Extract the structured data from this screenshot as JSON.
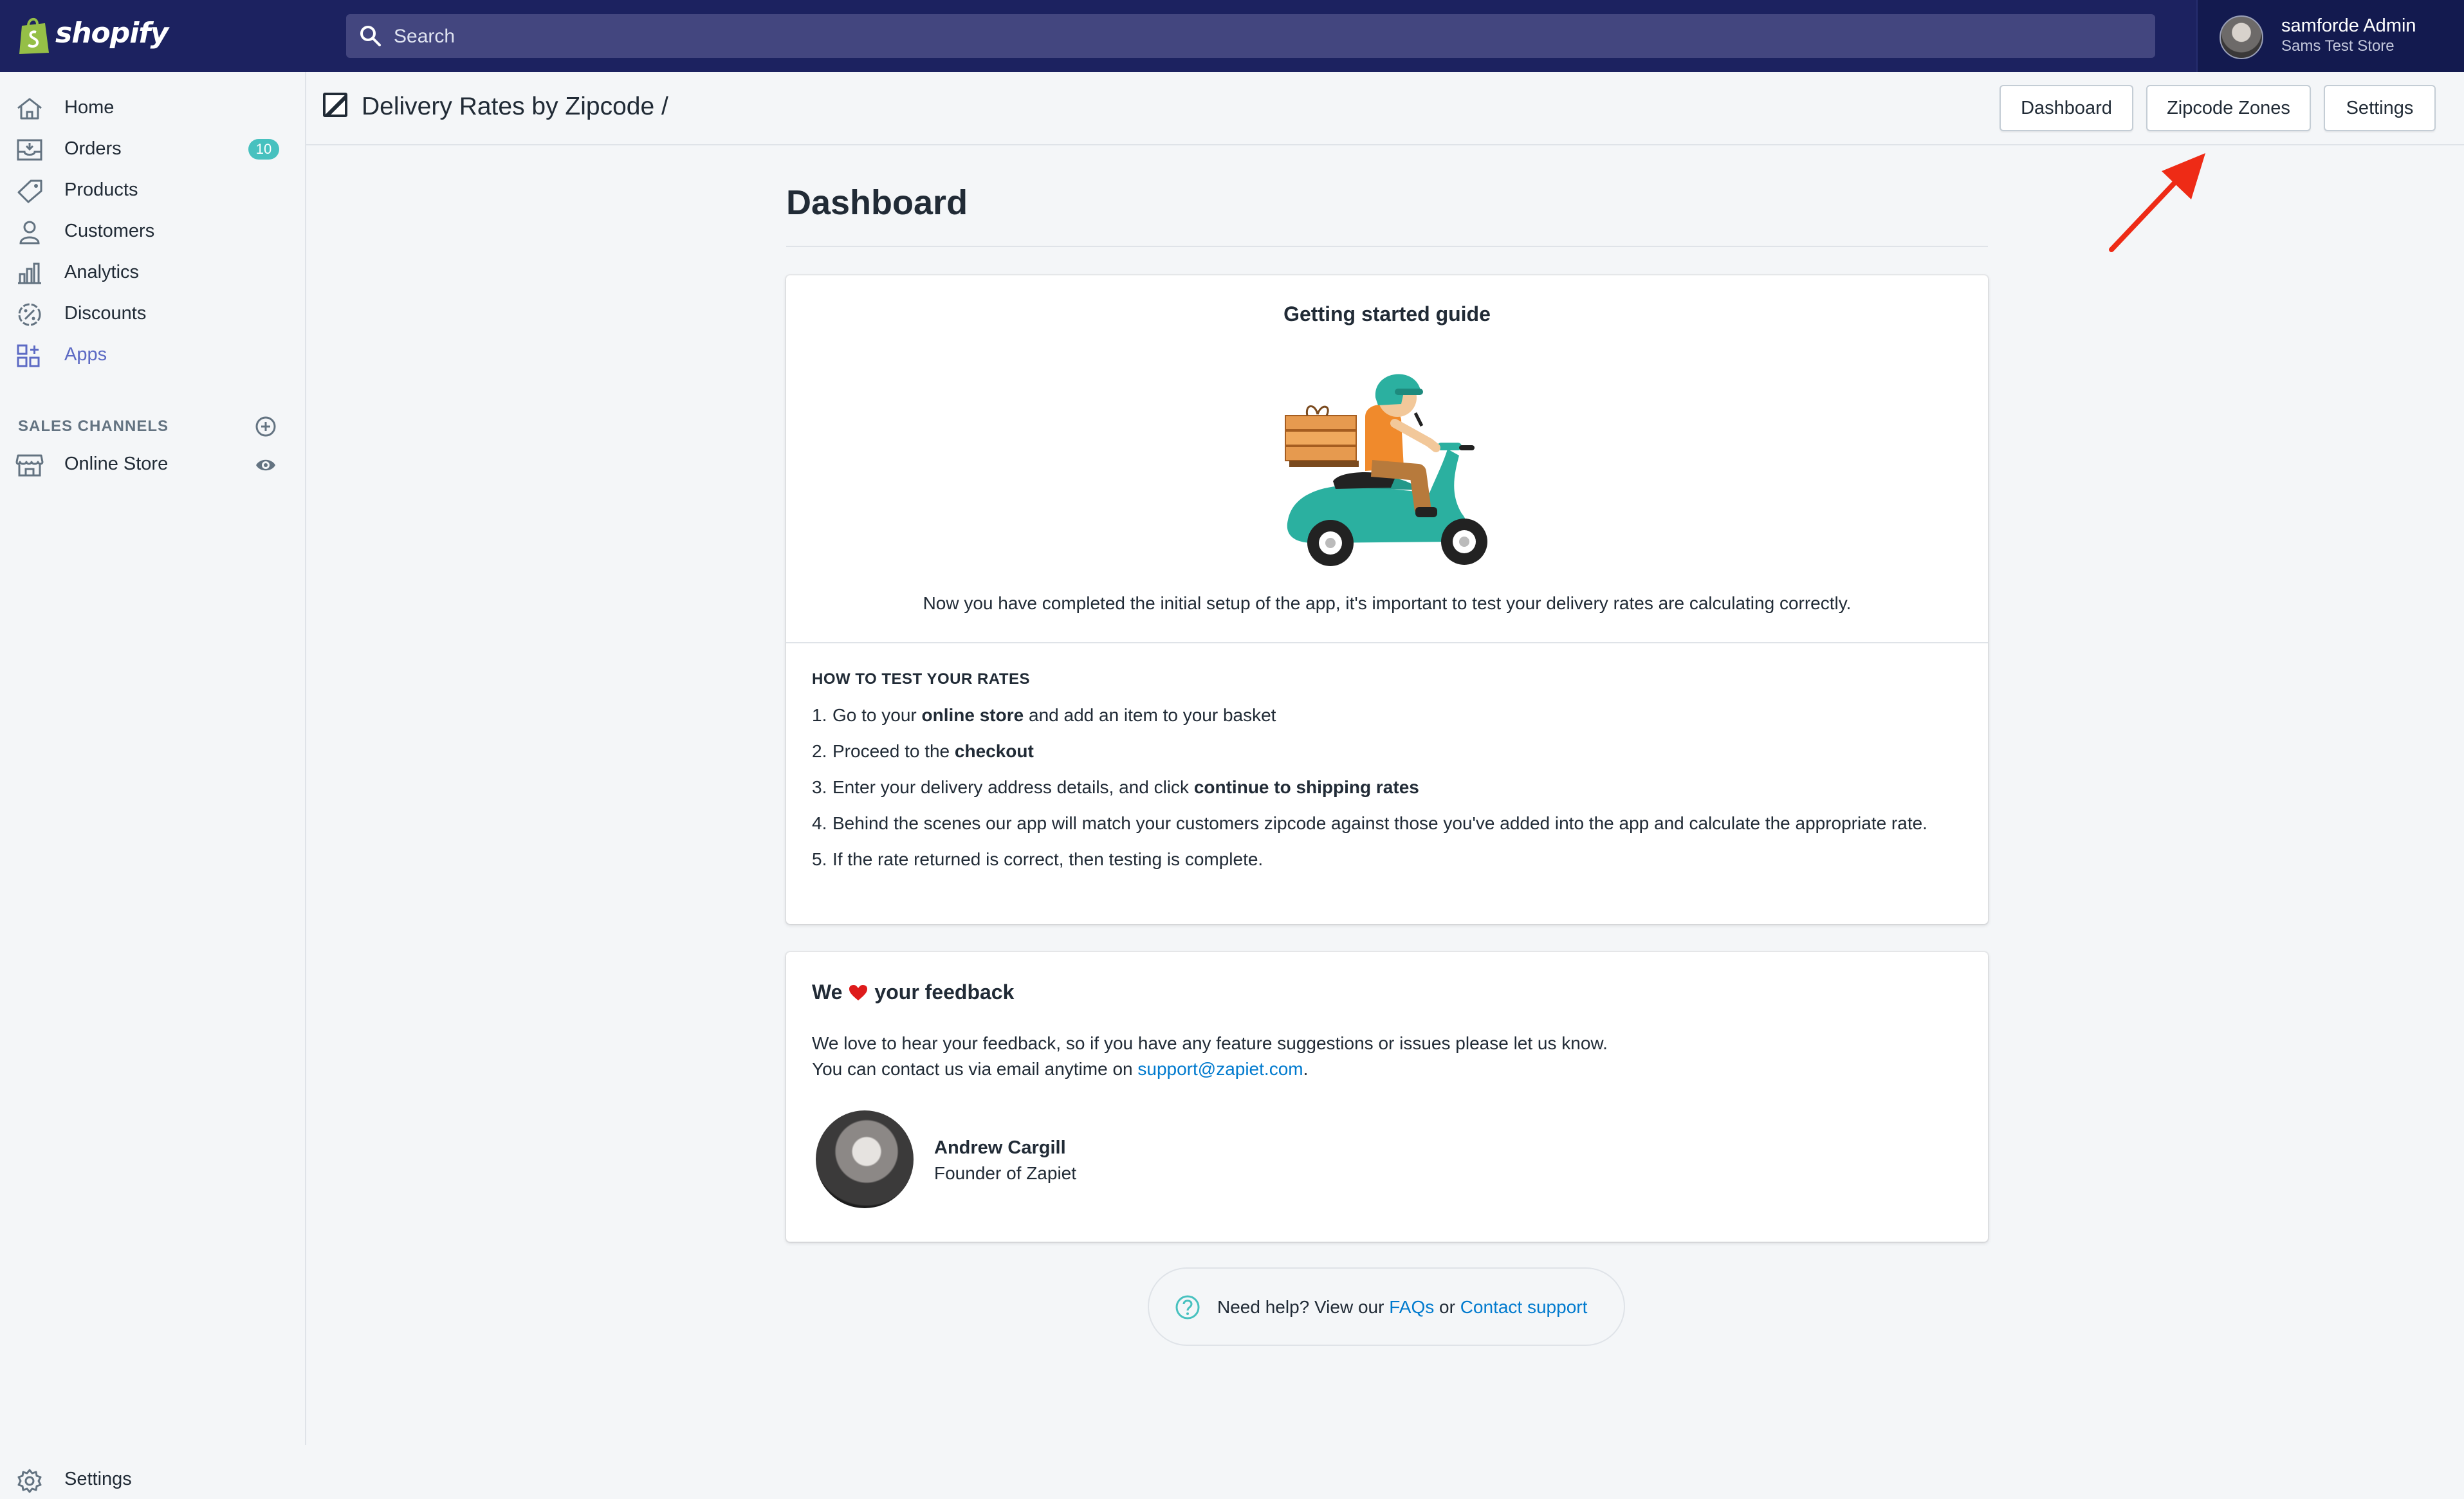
{
  "topbar": {
    "logo_text": "shopify",
    "search_placeholder": "Search",
    "user_name": "samforde Admin",
    "user_store": "Sams Test Store"
  },
  "sidebar": {
    "items": [
      {
        "label": "Home",
        "icon": "home-icon"
      },
      {
        "label": "Orders",
        "icon": "orders-icon",
        "badge": "10"
      },
      {
        "label": "Products",
        "icon": "products-icon"
      },
      {
        "label": "Customers",
        "icon": "customers-icon"
      },
      {
        "label": "Analytics",
        "icon": "analytics-icon"
      },
      {
        "label": "Discounts",
        "icon": "discounts-icon"
      },
      {
        "label": "Apps",
        "icon": "apps-icon",
        "active": true
      }
    ],
    "sales_channels_title": "SALES CHANNELS",
    "online_store_label": "Online Store",
    "settings_label": "Settings"
  },
  "header": {
    "app_title": "Delivery Rates by Zipcode /",
    "buttons": {
      "dashboard": "Dashboard",
      "zipcode_zones": "Zipcode Zones",
      "settings": "Settings"
    }
  },
  "main": {
    "page_title": "Dashboard",
    "guide": {
      "title": "Getting started guide",
      "intro": "Now you have completed the initial setup of the app, it's important to test your delivery rates are calculating correctly.",
      "how_title": "HOW TO TEST YOUR RATES",
      "steps": [
        {
          "num": "1.",
          "pre": "Go to your ",
          "bold": "online store",
          "post": " and add an item to your basket"
        },
        {
          "num": "2.",
          "pre": "Proceed to the ",
          "bold": "checkout",
          "post": ""
        },
        {
          "num": "3.",
          "pre": "Enter your delivery address details, and click ",
          "bold": "continue to shipping rates",
          "post": ""
        },
        {
          "num": "4.",
          "pre": "Behind the scenes our app will match your customers zipcode against those you've added into the app and calculate the appropriate rate.",
          "bold": "",
          "post": ""
        },
        {
          "num": "5.",
          "pre": "If the rate returned is correct, then testing is complete.",
          "bold": "",
          "post": ""
        }
      ]
    },
    "feedback": {
      "title_pre": "We",
      "title_post": "your feedback",
      "line1": "We love to hear your feedback, so if you have any feature suggestions or issues please let us know.",
      "line2_pre": "You can contact us via email anytime on ",
      "email": "support@zapiet.com",
      "line2_post": ".",
      "founder_name": "Andrew Cargill",
      "founder_role": "Founder of Zapiet"
    },
    "help": {
      "pre": "Need help? View our ",
      "faqs": "FAQs",
      "mid": " or ",
      "contact": "Contact support"
    }
  },
  "colors": {
    "topbar": "#1c2260",
    "accent": "#5c6ac4",
    "badge": "#47c1bf",
    "link": "#007ace",
    "arrow": "#ee2b16",
    "heart": "#de1b1b"
  }
}
